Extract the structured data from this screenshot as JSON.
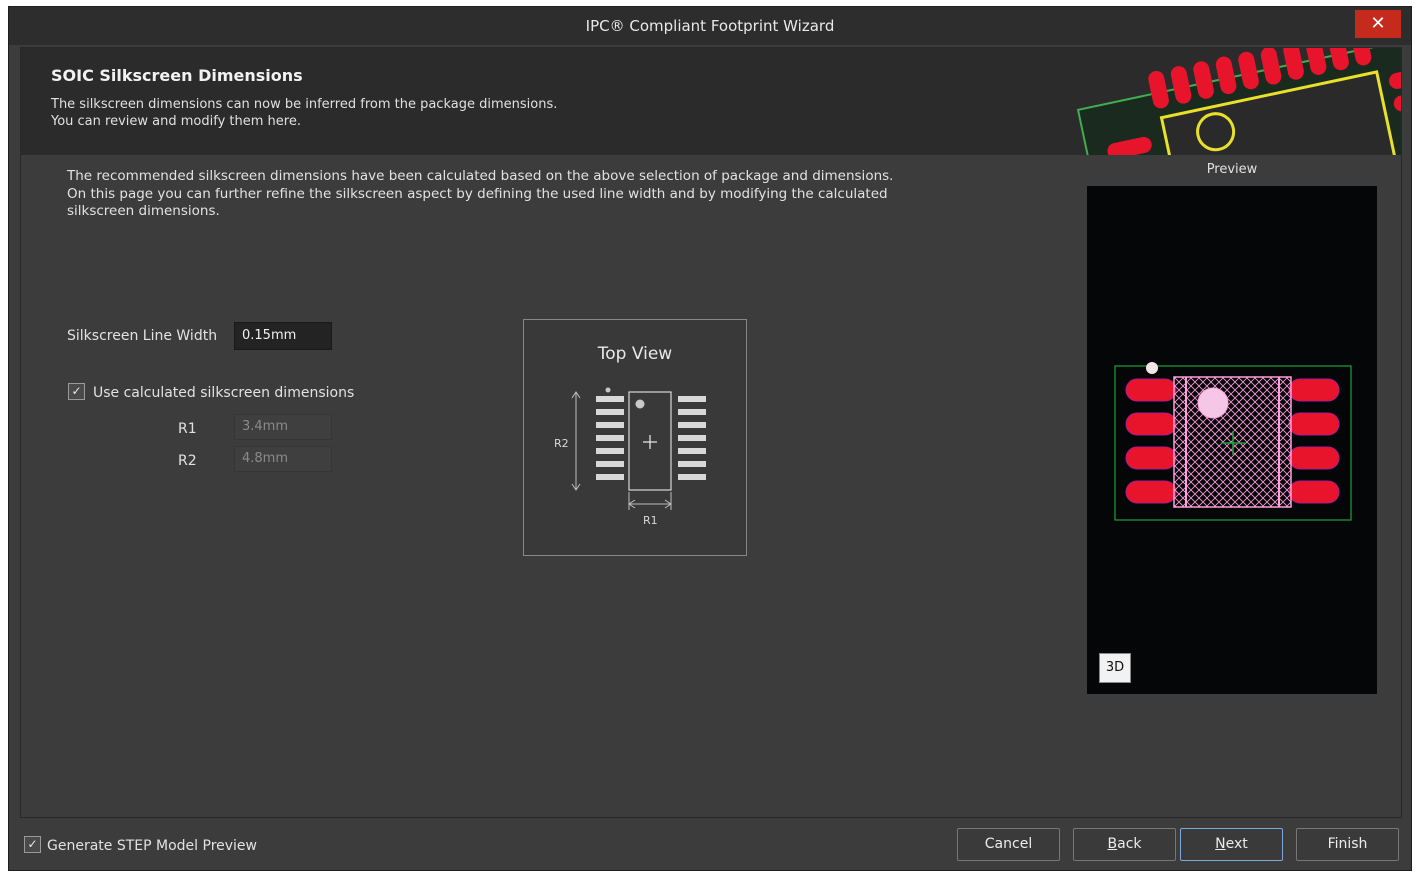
{
  "window": {
    "title": "IPC® Compliant Footprint Wizard",
    "close_glyph": "✕"
  },
  "header": {
    "title": "SOIC Silkscreen Dimensions",
    "desc_line1": "The silkscreen dimensions can now be inferred from the package dimensions.",
    "desc_line2": "You can review and modify them here."
  },
  "intro": {
    "line1": "The recommended silkscreen dimensions have been calculated based on the above selection of package and dimensions.",
    "line2": "On this page you can further refine the silkscreen aspect by defining the used line width and by modifying the calculated",
    "line3": "silkscreen dimensions."
  },
  "form": {
    "line_width_label": "Silkscreen Line Width",
    "line_width_value": "0.15mm",
    "use_calc_label": "Use calculated silkscreen dimensions",
    "use_calc_checked": true,
    "r1_label": "R1",
    "r1_value": "3.4mm",
    "r2_label": "R2",
    "r2_value": "4.8mm"
  },
  "topview": {
    "title": "Top View",
    "r1": "R1",
    "r2": "R2"
  },
  "preview": {
    "label": "Preview",
    "btn_3d": "3D"
  },
  "footer": {
    "step_label": "Generate STEP Model Preview",
    "step_checked": true,
    "cancel": "Cancel",
    "back_underline": "B",
    "back_rest": "ack",
    "next_underline": "N",
    "next_rest": "ext",
    "finish": "Finish"
  },
  "colors": {
    "accent": "#7fa7d8",
    "close": "#c42b1c",
    "pad": "#e8142c",
    "silk": "#ff9edc",
    "outline": "#1fa23a"
  }
}
